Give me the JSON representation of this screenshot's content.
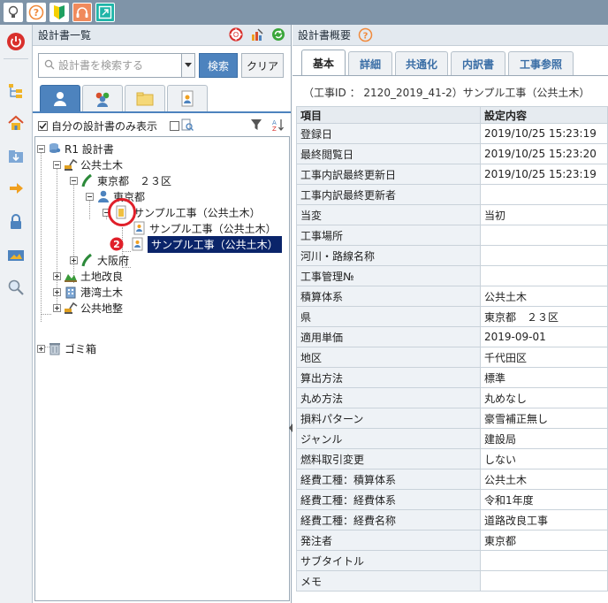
{
  "topbar": {
    "icons": [
      "lightbulb-icon",
      "help-icon",
      "beginner-mark-icon",
      "headset-icon",
      "expand-icon"
    ]
  },
  "rail": {
    "icons": [
      "power-icon",
      "tree-layout-icon",
      "home-icon",
      "download-folder-icon",
      "arrow-right-icon",
      "lock-icon",
      "image-card-icon",
      "magnifier-icon"
    ]
  },
  "left_panel": {
    "title": "設計書一覧",
    "search": {
      "placeholder": "設計書を検索する",
      "search_label": "検索",
      "clear_label": "クリア"
    },
    "filter": {
      "mine_only_label": "自分の設計書のみ表示"
    },
    "tree": [
      {
        "label": "R1 設計書"
      },
      {
        "label": "公共土木"
      },
      {
        "label": "東京都　２３区"
      },
      {
        "label": "東京都"
      },
      {
        "label": "サンプル工事（公共土木）"
      },
      {
        "label": "サンプル工事（公共土木）"
      },
      {
        "label": "サンプル工事（公共土木）",
        "marker": "2"
      },
      {
        "label": "大阪府"
      },
      {
        "label": "土地改良"
      },
      {
        "label": "港湾土木"
      },
      {
        "label": "公共地整"
      },
      {
        "label": "ゴミ箱"
      }
    ]
  },
  "right_panel": {
    "title": "設計書概要",
    "tabs": [
      "基本",
      "詳細",
      "共通化",
      "内訳書",
      "工事参照"
    ],
    "active_tab": "基本",
    "project_line": "（工事ID ： 2120_2019_41-2）サンプル工事（公共土木）",
    "columns": [
      "項目",
      "設定内容"
    ],
    "rows": [
      [
        "登録日",
        "2019/10/25 15:23:19"
      ],
      [
        "最終閲覧日",
        "2019/10/25 15:23:20"
      ],
      [
        "工事内訳最終更新日",
        "2019/10/25 15:23:19"
      ],
      [
        "工事内訳最終更新者",
        ""
      ],
      [
        "当変",
        "当初"
      ],
      [
        "工事場所",
        ""
      ],
      [
        "河川・路線名称",
        ""
      ],
      [
        "工事管理№",
        ""
      ],
      [
        "積算体系",
        "公共土木"
      ],
      [
        "県",
        "東京都　２３区"
      ],
      [
        "適用単価",
        "2019-09-01"
      ],
      [
        "地区",
        "千代田区"
      ],
      [
        "算出方法",
        "標準"
      ],
      [
        "丸め方法",
        "丸めなし"
      ],
      [
        "損料パターン",
        "豪雪補正無し"
      ],
      [
        "ジャンル",
        "建設局"
      ],
      [
        "燃料取引変更",
        "しない"
      ],
      [
        "経費工種：積算体系",
        "公共土木"
      ],
      [
        "経費工種：経費体系",
        "令和1年度"
      ],
      [
        "経費工種：経費名称",
        "道路改良工事"
      ],
      [
        "発注者",
        "東京都"
      ],
      [
        "サブタイトル",
        ""
      ],
      [
        "メモ",
        ""
      ]
    ]
  }
}
